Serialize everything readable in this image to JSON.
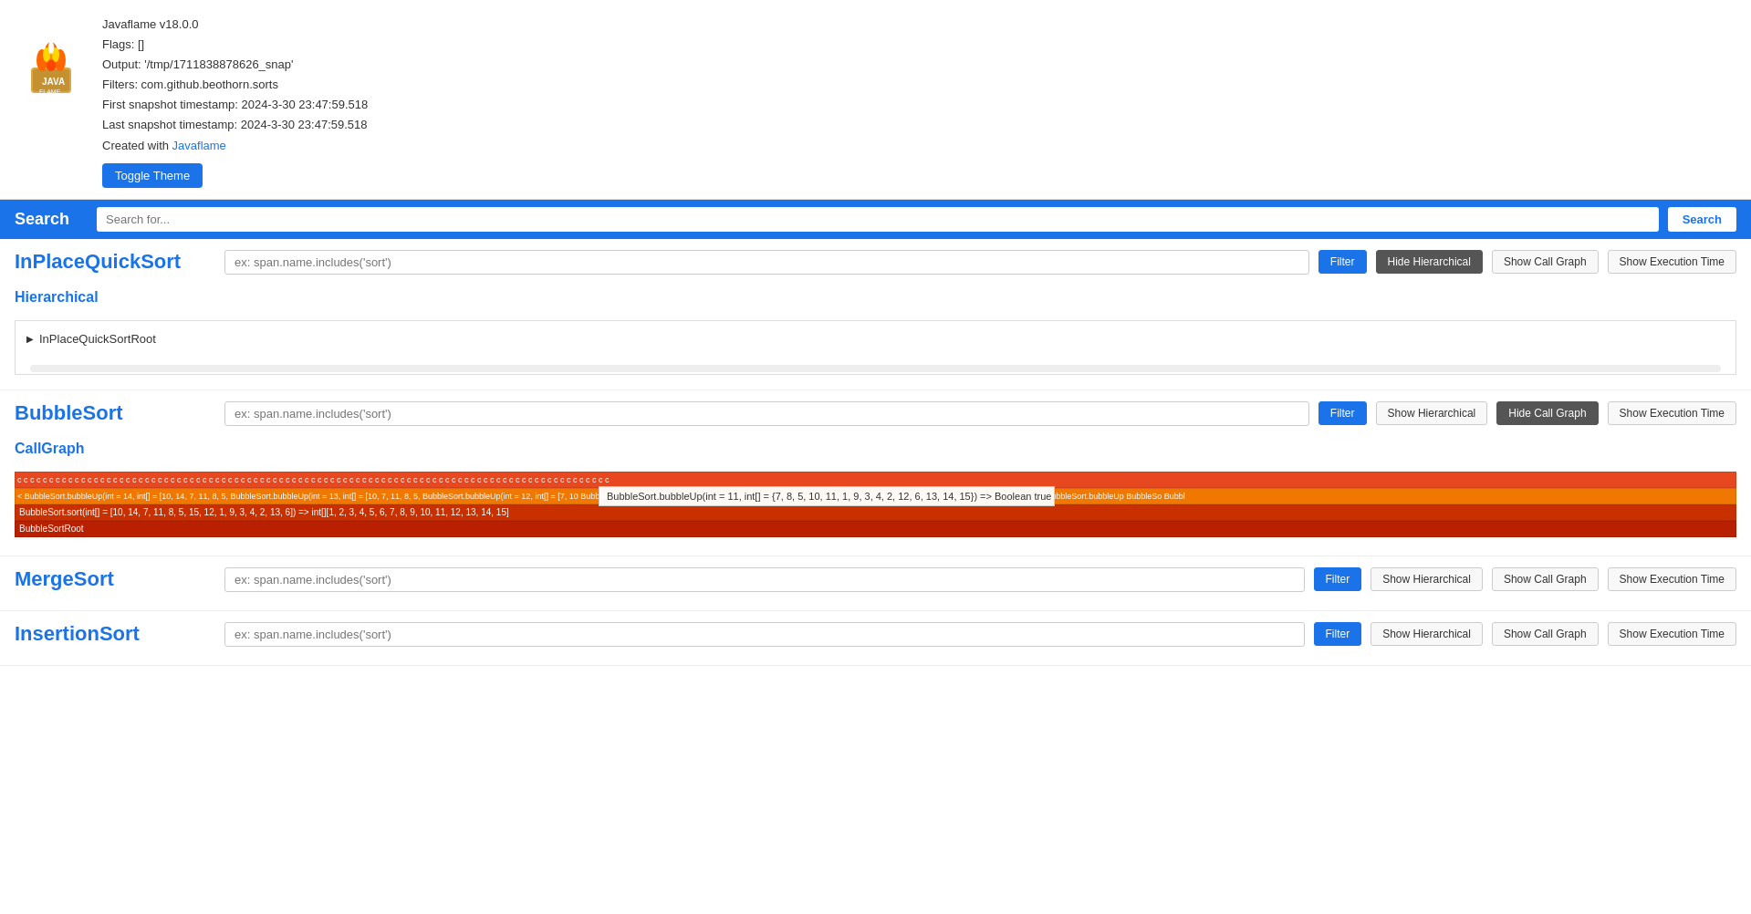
{
  "header": {
    "title": "Javaflame v18.0.0",
    "flags": "Flags: []",
    "output": "Output: '/tmp/1711838878626_snap'",
    "filters": "Filters: com.github.beothorn.sorts",
    "first_snapshot": "First snapshot timestamp:  2024-3-30 23:47:59.518",
    "last_snapshot": "Last snapshot timestamp:  2024-3-30 23:47:59.518",
    "created_by_prefix": "Created with ",
    "created_by_link": "Javaflame",
    "toggle_theme_label": "Toggle Theme"
  },
  "search": {
    "label": "Search",
    "placeholder": "Search for...",
    "button_label": "Search"
  },
  "sections": [
    {
      "id": "inplace-quick-sort",
      "title": "InPlaceQuickSort",
      "filter_placeholder": "ex: span.name.includes('sort')",
      "filter_label": "Filter",
      "btn_hierarchical": "Hide Hierarchical",
      "btn_hierarchical_active": true,
      "btn_call_graph": "Show Call Graph",
      "btn_call_graph_active": false,
      "btn_execution_time": "Show Execution Time",
      "btn_execution_time_active": false,
      "mode": "hierarchical",
      "sub_title": "Hierarchical",
      "tree_node": "InPlaceQuickSortRoot"
    },
    {
      "id": "bubble-sort",
      "title": "BubbleSort",
      "filter_placeholder": "ex: span.name.includes('sort')",
      "filter_label": "Filter",
      "btn_hierarchical": "Show Hierarchical",
      "btn_hierarchical_active": false,
      "btn_call_graph": "Hide Call Graph",
      "btn_call_graph_active": true,
      "btn_execution_time": "Show Execution Time",
      "btn_execution_time_active": false,
      "mode": "callgraph",
      "sub_title": "CallGraph",
      "tooltip_text": "BubbleSort.bubbleUp(int = 11, int[] = {7, 8, 5, 10, 11, 1, 9, 3, 4, 2, 12, 6, 13, 14, 15}) => Boolean true",
      "row1_text": "< BubbleSort.bubbleUp(int = 14, int[] = [10, 14, 7, 11, 8, 5,  BubbleSort.bubbleUp(int = 13, int[] = [10, 7, 11, 8, 5,  BubbleSort.bubbleUp(int = 12, int[] = [7, 10  BubbleSort.bubbleUp(int = 11, int[] = [  BubbleSort.bubbleUp(int = 10, int[] =   BubbleSort.bubbleUp(int =   BubbleSort.bubbleUp(int  BubbleSort.bubbleUp  BubbleSo  Bubbl",
      "row2_text": "BubbleSort.sort(int[] = [10, 14, 7, 11, 8, 5, 15, 12, 1, 9, 3, 4, 2, 13, 6]) => int[][1, 2, 3, 4, 5, 6, 7, 8, 9, 10, 11, 12, 13, 14, 15]",
      "row3_text": "BubbleSortRoot"
    },
    {
      "id": "merge-sort",
      "title": "MergeSort",
      "filter_placeholder": "ex: span.name.includes('sort')",
      "filter_label": "Filter",
      "btn_hierarchical": "Show Hierarchical",
      "btn_hierarchical_active": false,
      "btn_call_graph": "Show Call Graph",
      "btn_call_graph_active": false,
      "btn_execution_time": "Show Execution Time",
      "btn_execution_time_active": false,
      "mode": "none"
    },
    {
      "id": "insertion-sort",
      "title": "InsertionSort",
      "filter_placeholder": "ex: span.name.includes('sort')",
      "filter_label": "Filter",
      "btn_hierarchical": "Show Hierarchical",
      "btn_hierarchical_active": false,
      "btn_call_graph": "Show Call Graph",
      "btn_call_graph_active": false,
      "btn_execution_time": "Show Execution Time",
      "btn_execution_time_active": false,
      "mode": "none"
    }
  ]
}
